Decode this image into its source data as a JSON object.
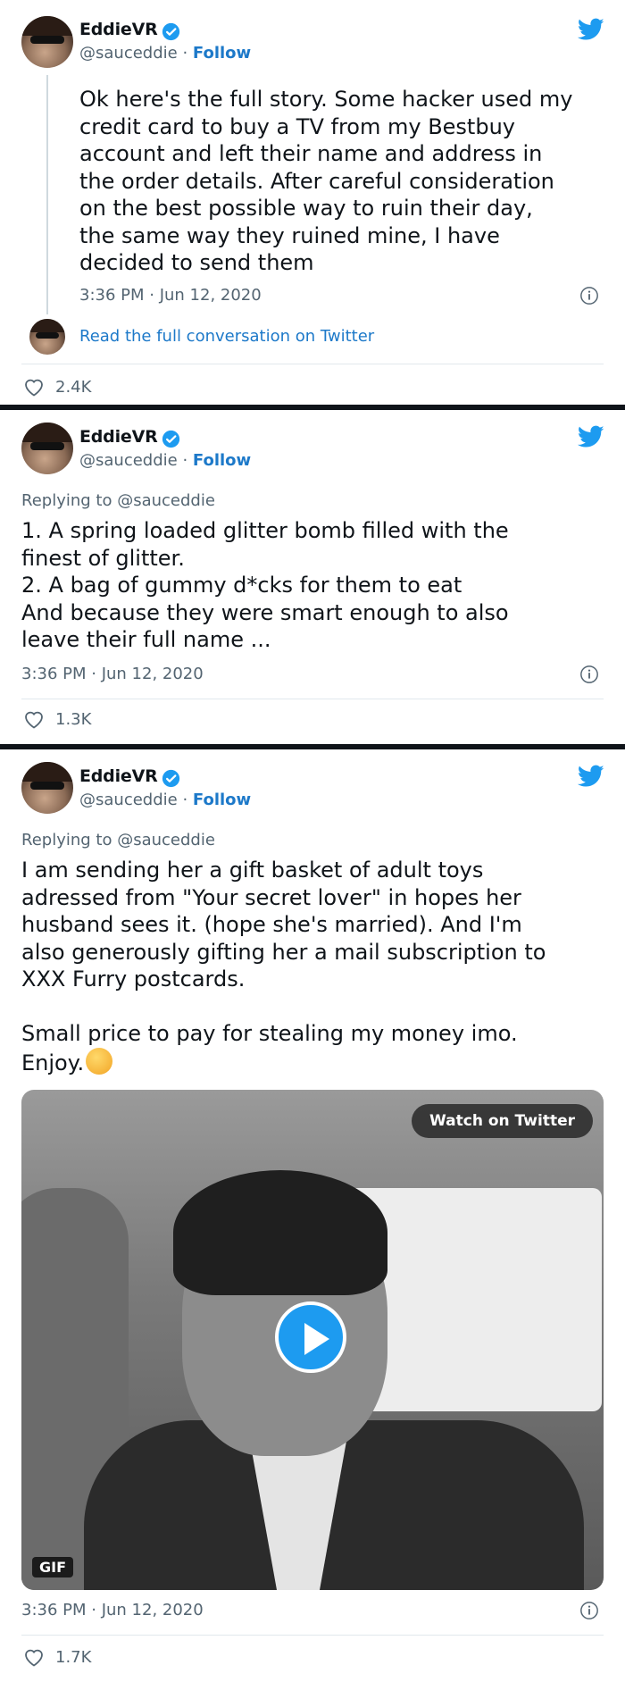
{
  "tweets": [
    {
      "author": {
        "name": "EddieVR",
        "handle": "@sauceddie",
        "follow": "Follow",
        "separator": " · "
      },
      "text": "Ok here's the full story. Some hacker used my\ncredit card to buy a TV from my Bestbuy\naccount and left their name and address in\nthe order details. After careful consideration\non the best possible way to ruin their day,\nthe same way they ruined mine, I have\ndecided to send them",
      "timestamp": "3:36 PM · Jun 12, 2020",
      "read_more": "Read the full conversation on Twitter",
      "likes": "2.4K"
    },
    {
      "author": {
        "name": "EddieVR",
        "handle": "@sauceddie",
        "follow": "Follow",
        "separator": " · "
      },
      "replying_to": "Replying to @sauceddie",
      "text": "1. A spring loaded glitter bomb filled with the\nfinest of glitter.\n2. A bag of gummy d*cks for them to eat\nAnd because they were smart enough to also\nleave their full name ...",
      "timestamp": "3:36 PM · Jun 12, 2020",
      "likes": "1.3K"
    },
    {
      "author": {
        "name": "EddieVR",
        "handle": "@sauceddie",
        "follow": "Follow",
        "separator": " · "
      },
      "replying_to": "Replying to @sauceddie",
      "text": "I am sending her a gift basket of adult toys\nadressed from \"Your secret lover\" in hopes her\nhusband sees it. (hope she's married). And I'm\nalso generously gifting her a mail subscription to\nXXX Furry postcards.\n\nSmall price to pay for stealing my money imo.\nEnjoy.",
      "emoji": "shushing-face-emoji",
      "media": {
        "watch_label": "Watch on Twitter",
        "badge": "GIF"
      },
      "timestamp": "3:36 PM · Jun 12, 2020",
      "likes": "1.7K"
    }
  ],
  "colors": {
    "accent": "#1d9bf0",
    "link": "#1d79c9",
    "muted": "#536471"
  },
  "icons": [
    "twitter-bird-icon",
    "verified-badge-icon",
    "info-icon",
    "heart-icon",
    "play-icon"
  ]
}
